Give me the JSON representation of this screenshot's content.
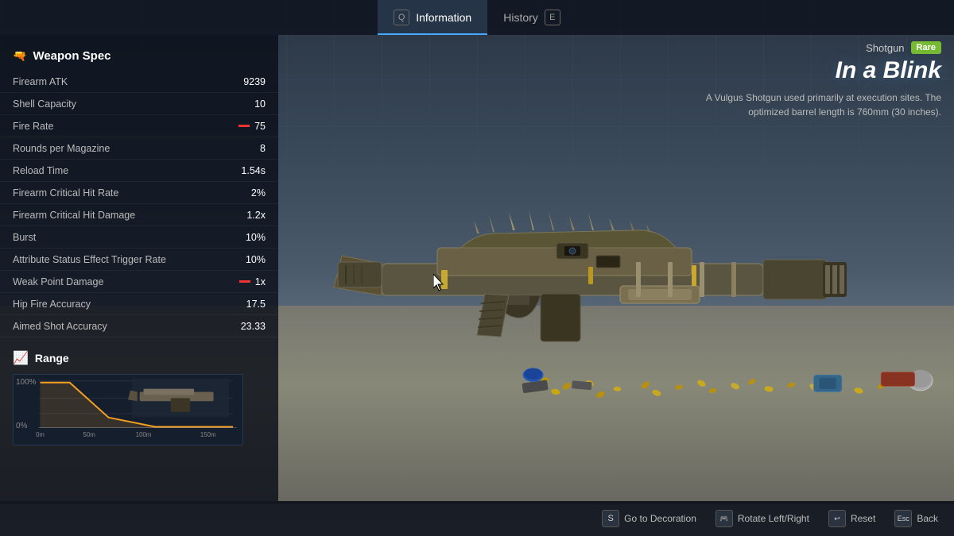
{
  "nav": {
    "tabs": [
      {
        "id": "information",
        "label": "Information",
        "key": "Q",
        "active": true
      },
      {
        "id": "history",
        "label": "History",
        "key": "E",
        "active": false
      }
    ]
  },
  "weapon_spec": {
    "section_title": "Weapon Spec",
    "stats": [
      {
        "label": "Firearm ATK",
        "value": "9239",
        "has_bar": false
      },
      {
        "label": "Shell Capacity",
        "value": "10",
        "has_bar": false
      },
      {
        "label": "Fire Rate",
        "value": "75",
        "has_bar": true
      },
      {
        "label": "Rounds per Magazine",
        "value": "8",
        "has_bar": false
      },
      {
        "label": "Reload Time",
        "value": "1.54s",
        "has_bar": false
      },
      {
        "label": "Firearm Critical Hit Rate",
        "value": "2%",
        "has_bar": false
      },
      {
        "label": "Firearm Critical Hit Damage",
        "value": "1.2x",
        "has_bar": false
      },
      {
        "label": "Burst",
        "value": "10%",
        "has_bar": false
      },
      {
        "label": "Attribute Status Effect Trigger Rate",
        "value": "10%",
        "has_bar": false
      },
      {
        "label": "Weak Point Damage",
        "value": "1x",
        "has_bar": true
      },
      {
        "label": "Hip Fire Accuracy",
        "value": "17.5",
        "has_bar": false
      },
      {
        "label": "Aimed Shot Accuracy",
        "value": "23.33",
        "has_bar": false
      }
    ]
  },
  "range": {
    "section_title": "Range",
    "chart": {
      "x_labels": [
        "0m",
        "50m",
        "100m",
        "150m"
      ],
      "y_labels": [
        "100%",
        "0%"
      ]
    }
  },
  "weapon_info": {
    "type": "Shotgun",
    "rarity": "Rare",
    "name": "In a Blink",
    "description": "A Vulgus Shotgun used primarily at execution sites. The optimized barrel length is 760mm (30 inches)."
  },
  "bottom_bar": {
    "actions": [
      {
        "key": "S",
        "label": "Go to Decoration"
      },
      {
        "key": "🎮",
        "label": "Rotate Left/Right"
      },
      {
        "key": "🔄",
        "label": "Reset"
      },
      {
        "key": "Esc",
        "label": "Back"
      }
    ]
  },
  "colors": {
    "accent": "#4aaeff",
    "rare": "#88bb33",
    "bar_red": "#ee3333",
    "panel_bg": "rgba(10,15,25,0.82)"
  }
}
